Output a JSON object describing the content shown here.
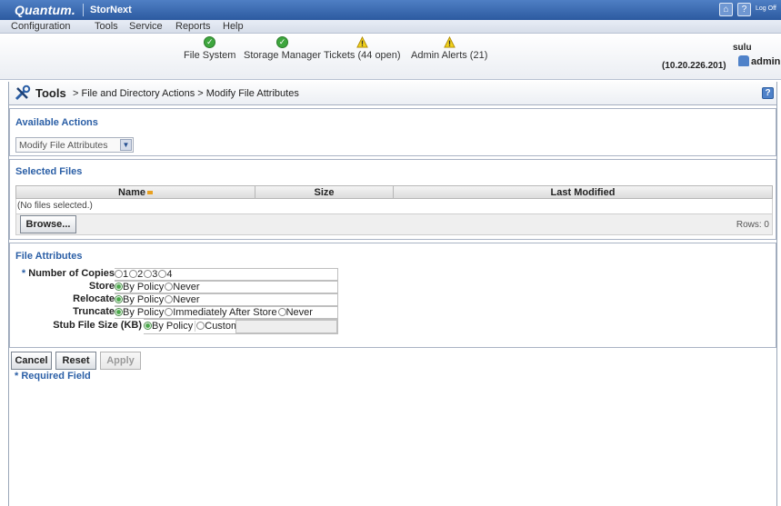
{
  "app": {
    "brand": "Quantum.",
    "product": "StorNext",
    "logoff_label": "Log Off"
  },
  "menu": [
    "Configuration",
    "Tools",
    "Service",
    "Reports",
    "Help"
  ],
  "status": [
    {
      "label": "File System",
      "state": "ok"
    },
    {
      "label": "Storage Manager",
      "state": "ok"
    },
    {
      "label": "Tickets (44 open)",
      "state": "warn"
    },
    {
      "label": "Admin Alerts (21)",
      "state": "warn"
    }
  ],
  "user": {
    "host": "sulu",
    "ip": "(10.20.226.201)",
    "name": "admin"
  },
  "breadcrumb": {
    "title": "Tools",
    "path": "> File and Directory Actions > Modify File Attributes"
  },
  "available_actions": {
    "title": "Available Actions",
    "selected": "Modify File Attributes"
  },
  "selected_files": {
    "title": "Selected Files",
    "columns": [
      "Name",
      "Size",
      "Last Modified"
    ],
    "empty_text": "(No files selected.)",
    "browse_label": "Browse...",
    "rows_label": "Rows: 0"
  },
  "file_attributes": {
    "title": "File Attributes",
    "copies": {
      "label": "Number of Copies",
      "options": [
        "1",
        "2",
        "3",
        "4"
      ],
      "required_mark": "*"
    },
    "store": {
      "label": "Store",
      "options": [
        "By Policy",
        "Never"
      ],
      "selected": "By Policy"
    },
    "relocate": {
      "label": "Relocate",
      "options": [
        "By Policy",
        "Never"
      ],
      "selected": "By Policy"
    },
    "truncate": {
      "label": "Truncate",
      "options": [
        "By Policy",
        "Immediately After Store",
        "Never"
      ],
      "selected": "By Policy"
    },
    "stub": {
      "label": "Stub File Size (KB)",
      "options": [
        "By Policy",
        "Custom"
      ],
      "selected": "By Policy",
      "custom_value": ""
    }
  },
  "actions": {
    "cancel": "Cancel",
    "reset": "Reset",
    "apply": "Apply"
  },
  "required_note": "* Required Field",
  "colors": {
    "accent": "#2b5fa6",
    "titlebar": "#2c5aa0",
    "ok": "#3ea63e",
    "warn": "#e6b800"
  }
}
